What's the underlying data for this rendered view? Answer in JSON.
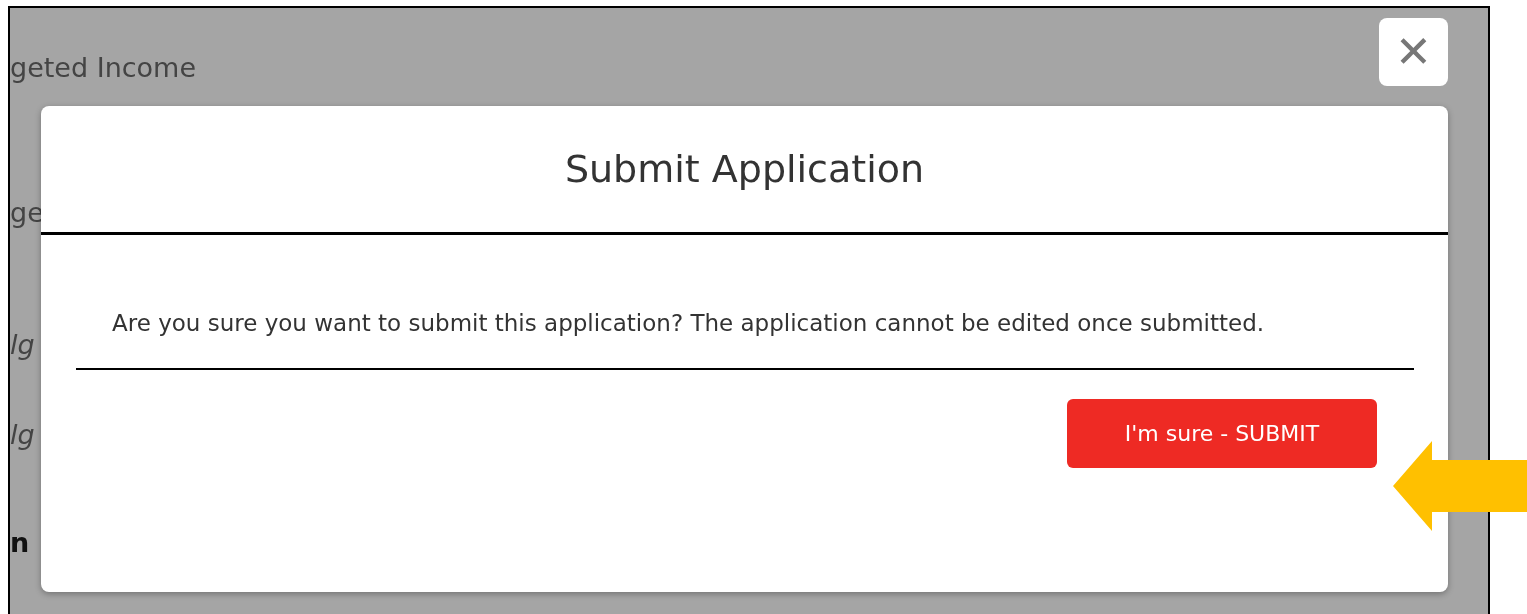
{
  "background_page": {
    "lines": [
      {
        "text": "geted Income",
        "kind": "plain"
      },
      {
        "text": "ge",
        "kind": "plain"
      },
      {
        "text": "lg",
        "kind": "emphasis"
      },
      {
        "text": "lg",
        "kind": "emphasis"
      },
      {
        "text": "n",
        "kind": "heading"
      }
    ]
  },
  "close_button": {
    "label": "✕"
  },
  "dialog": {
    "title": "Submit Application",
    "message": "Are you sure you want to submit this application? The application cannot be edited once submitted.",
    "buttons": [
      {
        "label": "I'm sure - SUBMIT",
        "kind": "primary"
      }
    ]
  },
  "annotation": {
    "kind": "arrow",
    "color": "#ffc000"
  }
}
